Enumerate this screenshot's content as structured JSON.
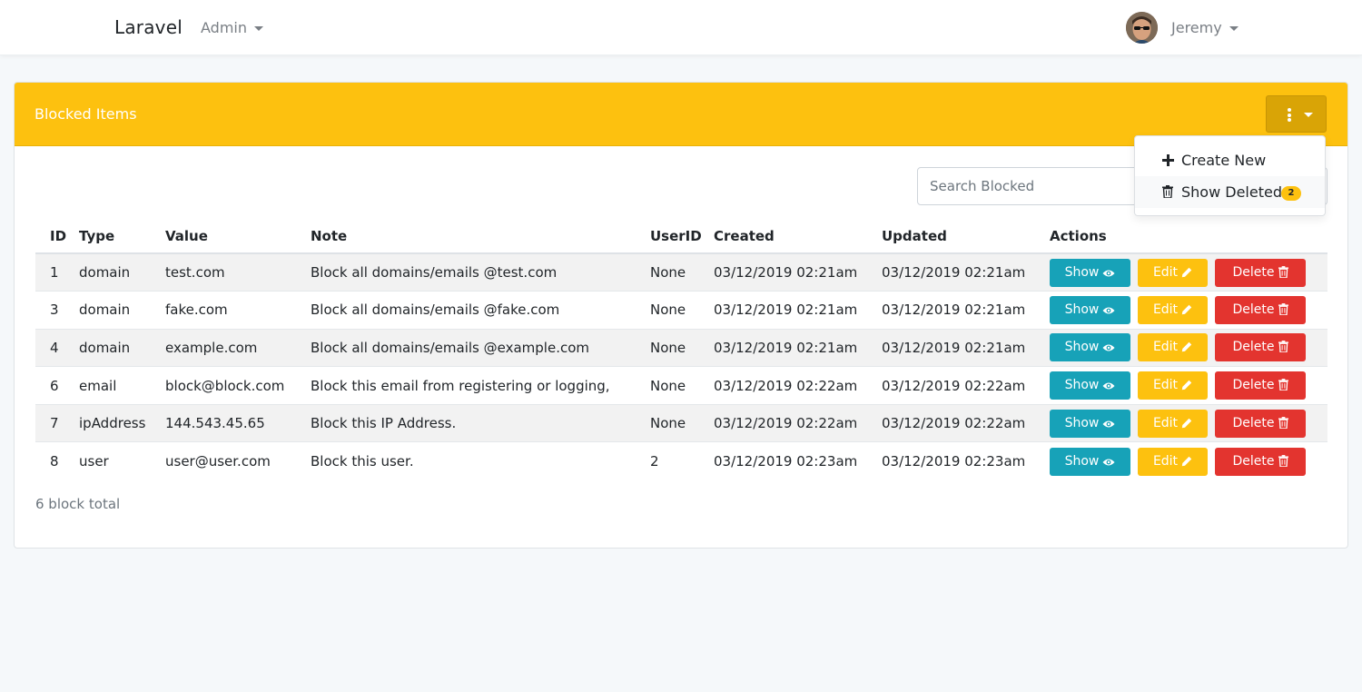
{
  "navbar": {
    "brand": "Laravel",
    "admin_menu": "Admin",
    "user_menu": "Jeremy"
  },
  "card": {
    "title": "Blocked Items"
  },
  "search": {
    "placeholder": "Search Blocked"
  },
  "dropdown": {
    "create_new": "Create New",
    "show_deleted": "Show Deleted",
    "deleted_count": "2"
  },
  "table": {
    "headers": [
      "ID",
      "Type",
      "Value",
      "Note",
      "UserID",
      "Created",
      "Updated",
      "Actions"
    ],
    "rows": [
      {
        "id": "1",
        "type": "domain",
        "value": "test.com",
        "note": "Block all domains/emails @test.com",
        "user_id": "None",
        "created": "03/12/2019 02:21am",
        "updated": "03/12/2019 02:21am"
      },
      {
        "id": "3",
        "type": "domain",
        "value": "fake.com",
        "note": "Block all domains/emails @fake.com",
        "user_id": "None",
        "created": "03/12/2019 02:21am",
        "updated": "03/12/2019 02:21am"
      },
      {
        "id": "4",
        "type": "domain",
        "value": "example.com",
        "note": "Block all domains/emails @example.com",
        "user_id": "None",
        "created": "03/12/2019 02:21am",
        "updated": "03/12/2019 02:21am"
      },
      {
        "id": "6",
        "type": "email",
        "value": "block@block.com",
        "note": "Block this email from registering or logging,",
        "user_id": "None",
        "created": "03/12/2019 02:22am",
        "updated": "03/12/2019 02:22am"
      },
      {
        "id": "7",
        "type": "ipAddress",
        "value": "144.543.45.65",
        "note": "Block this IP Address.",
        "user_id": "None",
        "created": "03/12/2019 02:22am",
        "updated": "03/12/2019 02:22am"
      },
      {
        "id": "8",
        "type": "user",
        "value": "user@user.com",
        "note": "Block this user.",
        "user_id": "2",
        "created": "03/12/2019 02:23am",
        "updated": "03/12/2019 02:23am"
      }
    ],
    "actions": {
      "show": "Show",
      "edit": "Edit",
      "delete": "Delete"
    }
  },
  "footer": {
    "total": "6 block total"
  },
  "colors": {
    "header": "#fdc10f",
    "show": "#17a2b8",
    "edit": "#fdc10f",
    "delete": "#e3342f"
  },
  "icons": [
    "chevron-down-icon",
    "kebab-icon",
    "plus-icon",
    "trash-icon",
    "eye-icon",
    "pencil-icon"
  ]
}
